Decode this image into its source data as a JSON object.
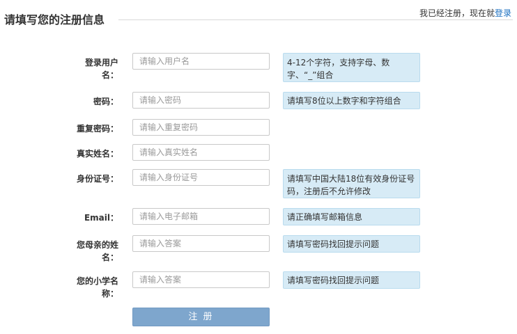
{
  "header": {
    "title": "请填写您的注册信息",
    "login_prompt": "我已经注册，现在就",
    "login_link": "登录"
  },
  "form": {
    "fields": [
      {
        "label": "登录用户名：",
        "placeholder": "请输入用户名",
        "hint": "4-12个字符，支持字母、数字、“_”组合"
      },
      {
        "label": "密码：",
        "placeholder": "请输入密码",
        "hint": "请填写8位以上数字和字符组合"
      },
      {
        "label": "重复密码：",
        "placeholder": "请输入重复密码",
        "hint": ""
      },
      {
        "label": "真实姓名：",
        "placeholder": "请输入真实姓名",
        "hint": ""
      },
      {
        "label": "身份证号：",
        "placeholder": "请输入身份证号",
        "hint": "请填写中国大陆18位有效身份证号码，注册后不允许修改"
      },
      {
        "label": "Email：",
        "placeholder": "请输入电子邮箱",
        "hint": "请正确填写邮箱信息"
      },
      {
        "label": "您母亲的姓名：",
        "placeholder": "请输入答案",
        "hint": "请填写密码找回提示问题"
      },
      {
        "label": "您的小学名称：",
        "placeholder": "请输入答案",
        "hint": "请填写密码找回提示问题"
      }
    ],
    "submit_label": "注 册"
  },
  "colors": {
    "hint_background": "#d7ebf6",
    "submit_background": "#7ea6cd",
    "link": "#1a6fc0"
  }
}
